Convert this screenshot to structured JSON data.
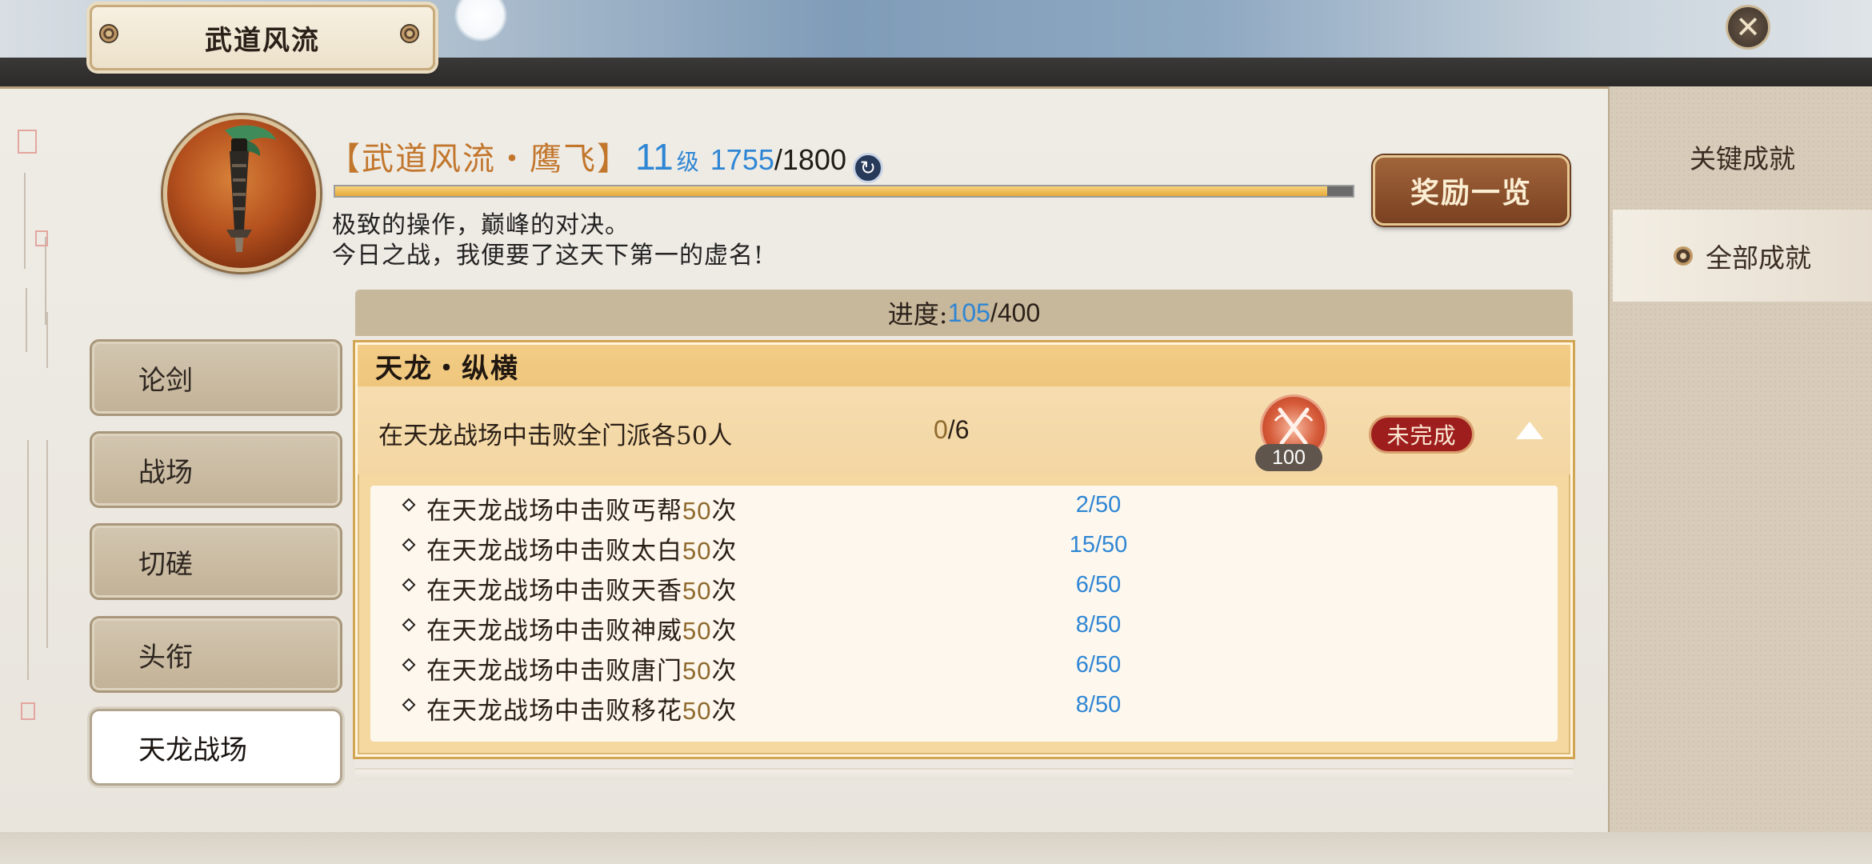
{
  "window": {
    "title": "武道风流",
    "close_icon": "close-icon"
  },
  "header": {
    "title": "【武道风流・鹰飞】",
    "level": "11",
    "level_unit": "级",
    "xp_current": "1755",
    "xp_separator": "/",
    "xp_max": "1800",
    "xp_fraction": 0.975,
    "refresh_icon": "refresh-icon",
    "desc_line1": "极致的操作，巅峰的对决。",
    "desc_line2": "今日之战，我便要了这天下第一的虚名!",
    "reward_button": "奖励一览"
  },
  "right_tabs": [
    {
      "label": "关键成就",
      "active": false
    },
    {
      "label": "全部成就",
      "active": true
    }
  ],
  "left_nav": [
    {
      "label": "论剑",
      "active": false
    },
    {
      "label": "战场",
      "active": false
    },
    {
      "label": "切磋",
      "active": false
    },
    {
      "label": "头衔",
      "active": false
    },
    {
      "label": "天龙战场",
      "active": true
    }
  ],
  "progress": {
    "label": "进度:",
    "current": "105",
    "separator": "/",
    "total": "400"
  },
  "achievement": {
    "group_title": "天龙・纵横",
    "task": "在天龙战场中击败全门派各50人",
    "count_current": "0",
    "count_sep": "/",
    "count_total": "6",
    "reward_points": "100",
    "status": "未完成",
    "collapse_icon": "triangle-up-icon",
    "subtasks": [
      {
        "prefix": "在天龙战场中击败丐帮",
        "num": "50",
        "suffix": "次",
        "progress": "2/50"
      },
      {
        "prefix": "在天龙战场中击败太白",
        "num": "50",
        "suffix": "次",
        "progress": "15/50"
      },
      {
        "prefix": "在天龙战场中击败天香",
        "num": "50",
        "suffix": "次",
        "progress": "6/50"
      },
      {
        "prefix": "在天龙战场中击败神威",
        "num": "50",
        "suffix": "次",
        "progress": "8/50"
      },
      {
        "prefix": "在天龙战场中击败唐门",
        "num": "50",
        "suffix": "次",
        "progress": "6/50"
      },
      {
        "prefix": "在天龙战场中击败移花",
        "num": "50",
        "suffix": "次",
        "progress": "8/50"
      }
    ]
  },
  "colors": {
    "accent_blue": "#2f86d4",
    "title_orange": "#c2762c",
    "status_red": "#9e1e1e",
    "highlight_gold": "#8f6a2e"
  }
}
